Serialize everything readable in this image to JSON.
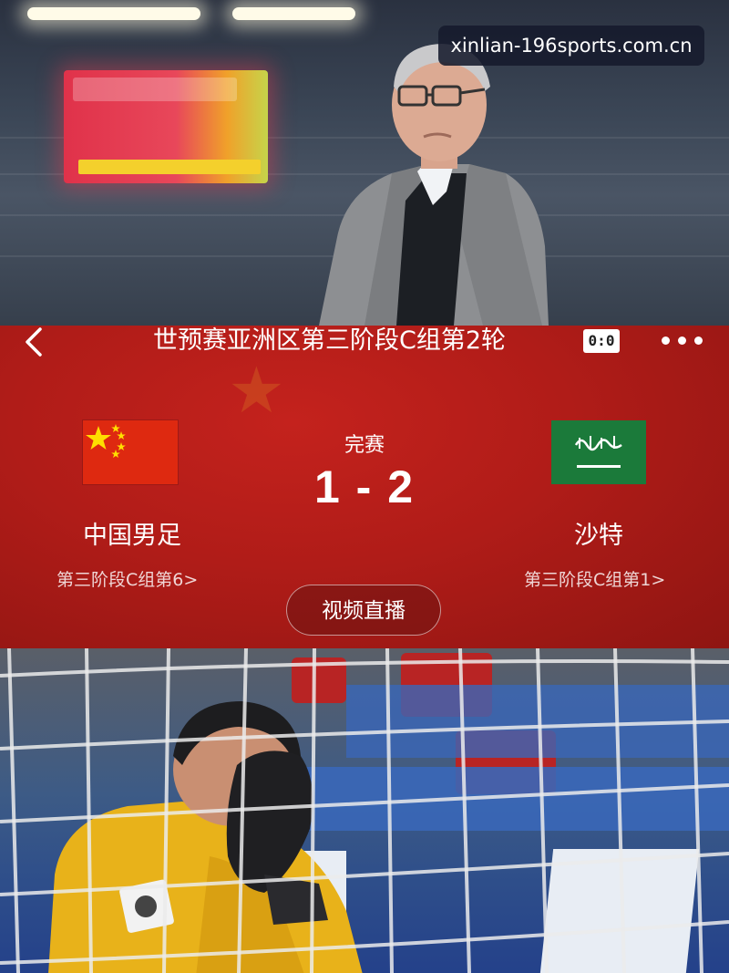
{
  "watermark": "xinlian-196sports.com.cn",
  "header": {
    "title": "世预赛亚洲区第三阶段C组第2轮",
    "mini_score": "0:0",
    "back_icon": "chevron-left-icon",
    "more_icon": "more-horizontal-icon"
  },
  "match": {
    "status": "完赛",
    "score": "1 - 2",
    "home": {
      "name": "中国男足",
      "rank": "第三阶段C组第6>",
      "flag": "china-flag-icon"
    },
    "away": {
      "name": "沙特",
      "rank": "第三阶段C组第1>",
      "flag": "saudi-flag-icon"
    },
    "live_button": "视频直播"
  },
  "colors": {
    "card_red": "#b01c18",
    "china_red": "#de2910",
    "china_yellow": "#ffde00",
    "saudi_green": "#1b7a3a",
    "watermark_bg": "#161a2c"
  }
}
